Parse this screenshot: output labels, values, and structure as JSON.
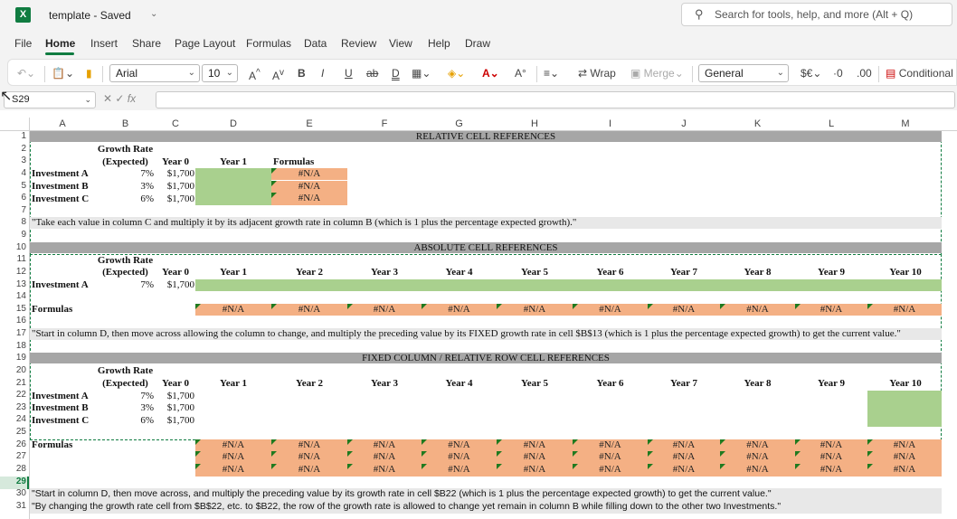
{
  "app": {
    "title": "template - Saved",
    "logo": "X"
  },
  "search": {
    "placeholder": "Search for tools, help, and more (Alt + Q)"
  },
  "menu": [
    "File",
    "Home",
    "Insert",
    "Share",
    "Page Layout",
    "Formulas",
    "Data",
    "Review",
    "View",
    "Help",
    "Draw"
  ],
  "ribbon": {
    "font": "Arial",
    "size": "10",
    "wrap": "Wrap",
    "merge": "Merge",
    "format": "General",
    "conditional": "Conditional",
    "currency": "$€"
  },
  "namebox": "S29",
  "columns": [
    "A",
    "B",
    "C",
    "D",
    "E",
    "F",
    "G",
    "H",
    "I",
    "J",
    "K",
    "L",
    "M"
  ],
  "rows": [
    "1",
    "2",
    "3",
    "4",
    "5",
    "6",
    "7",
    "8",
    "9",
    "10",
    "11",
    "12",
    "13",
    "14",
    "15",
    "16",
    "17",
    "18",
    "19",
    "20",
    "21",
    "22",
    "23",
    "24",
    "25",
    "26",
    "27",
    "28",
    "29",
    "30",
    "31"
  ],
  "sec1": {
    "band": "RELATIVE CELL REFERENCES",
    "growth1": "Growth Rate",
    "growth2": "(Expected)",
    "year0": "Year 0",
    "year1": "Year 1",
    "formulas": "Formulas",
    "rows": [
      {
        "name": "Investment A",
        "rate": "7%",
        "val": "$1,700",
        "f": "#N/A"
      },
      {
        "name": "Investment B",
        "rate": "3%",
        "val": "$1,700",
        "f": "#N/A"
      },
      {
        "name": "Investment C",
        "rate": "6%",
        "val": "$1,700",
        "f": "#N/A"
      }
    ],
    "note": "\"Take each value in column C and multiply it by its adjacent growth rate in column B (which is 1 plus the percentage expected growth).\""
  },
  "sec2": {
    "band": "ABSOLUTE CELL REFERENCES",
    "growth1": "Growth Rate",
    "growth2": "(Expected)",
    "year0": "Year 0",
    "years": [
      "Year 1",
      "Year 2",
      "Year 3",
      "Year 4",
      "Year 5",
      "Year 6",
      "Year 7",
      "Year 8",
      "Year 9",
      "Year 10"
    ],
    "inv": {
      "name": "Investment A",
      "rate": "7%",
      "val": "$1,700"
    },
    "formulas": "Formulas",
    "na": "#N/A",
    "note": "\"Start in column D, then move across allowing the column to change, and multiply the preceding value by its FIXED growth rate in cell $B$13 (which is 1 plus the percentage expected growth) to get the current value.\""
  },
  "sec3": {
    "band": "FIXED COLUMN / RELATIVE ROW CELL REFERENCES",
    "growth1": "Growth Rate",
    "growth2": "(Expected)",
    "year0": "Year 0",
    "years": [
      "Year 1",
      "Year 2",
      "Year 3",
      "Year 4",
      "Year 5",
      "Year 6",
      "Year 7",
      "Year 8",
      "Year 9",
      "Year 10"
    ],
    "rows": [
      {
        "name": "Investment A",
        "rate": "7%",
        "val": "$1,700"
      },
      {
        "name": "Investment B",
        "rate": "3%",
        "val": "$1,700"
      },
      {
        "name": "Investment C",
        "rate": "6%",
        "val": "$1,700"
      }
    ],
    "formulas": "Formulas",
    "na": "#N/A",
    "note1": "\"Start in column D, then move across, and multiply the preceding value by its growth rate in cell $B22 (which is 1 plus the percentage expected growth) to get the current value.\"",
    "note2": "\"By changing the growth rate cell from $B$22, etc. to $B22, the row of the growth rate is allowed to change yet remain in column B while filling down to the other two Investments.\""
  },
  "colors": {
    "green": "#a9d08e",
    "orange": "#f4b084",
    "band": "#a6a6a6",
    "accent": "#107c41"
  }
}
